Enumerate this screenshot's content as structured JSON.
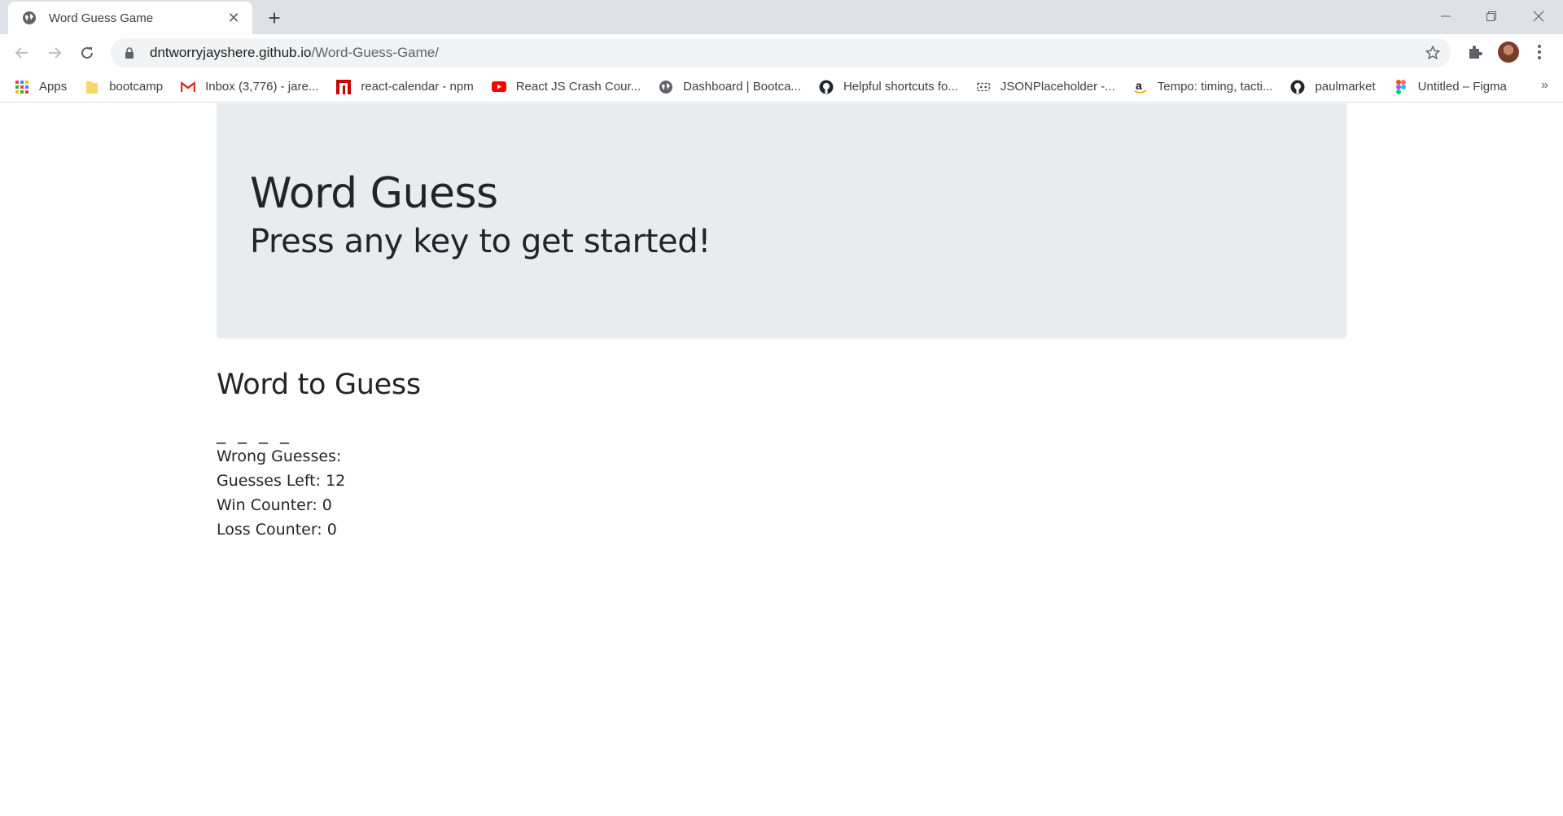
{
  "browser": {
    "tab_title": "Word Guess Game",
    "url_host": "dntworryjayshere.github.io",
    "url_path": "/Word-Guess-Game/",
    "bookmarks": [
      {
        "label": "Apps",
        "icon": "apps-grid-icon"
      },
      {
        "label": "bootcamp",
        "icon": "folder-icon"
      },
      {
        "label": "Inbox (3,776) - jare...",
        "icon": "gmail-icon"
      },
      {
        "label": "react-calendar - npm",
        "icon": "npm-icon"
      },
      {
        "label": "React JS Crash Cour...",
        "icon": "youtube-icon"
      },
      {
        "label": "Dashboard | Bootca...",
        "icon": "globe-icon"
      },
      {
        "label": "Helpful shortcuts fo...",
        "icon": "github-icon"
      },
      {
        "label": "JSONPlaceholder -...",
        "icon": "jsonplaceholder-icon"
      },
      {
        "label": "Tempo: timing, tacti...",
        "icon": "amazon-icon"
      },
      {
        "label": "paulmarket",
        "icon": "github-icon"
      },
      {
        "label": "Untitled – Figma",
        "icon": "figma-icon"
      }
    ],
    "more_bookmarks": "»"
  },
  "page": {
    "title": "Word Guess",
    "subtitle": "Press any key to get started!",
    "word_heading": "Word to Guess",
    "blanks": "_ _ _ _",
    "wrong_guesses": "Wrong Guesses:",
    "guesses_left": "Guesses Left: 12",
    "win_counter": "Win Counter: 0",
    "loss_counter": "Loss Counter: 0"
  }
}
